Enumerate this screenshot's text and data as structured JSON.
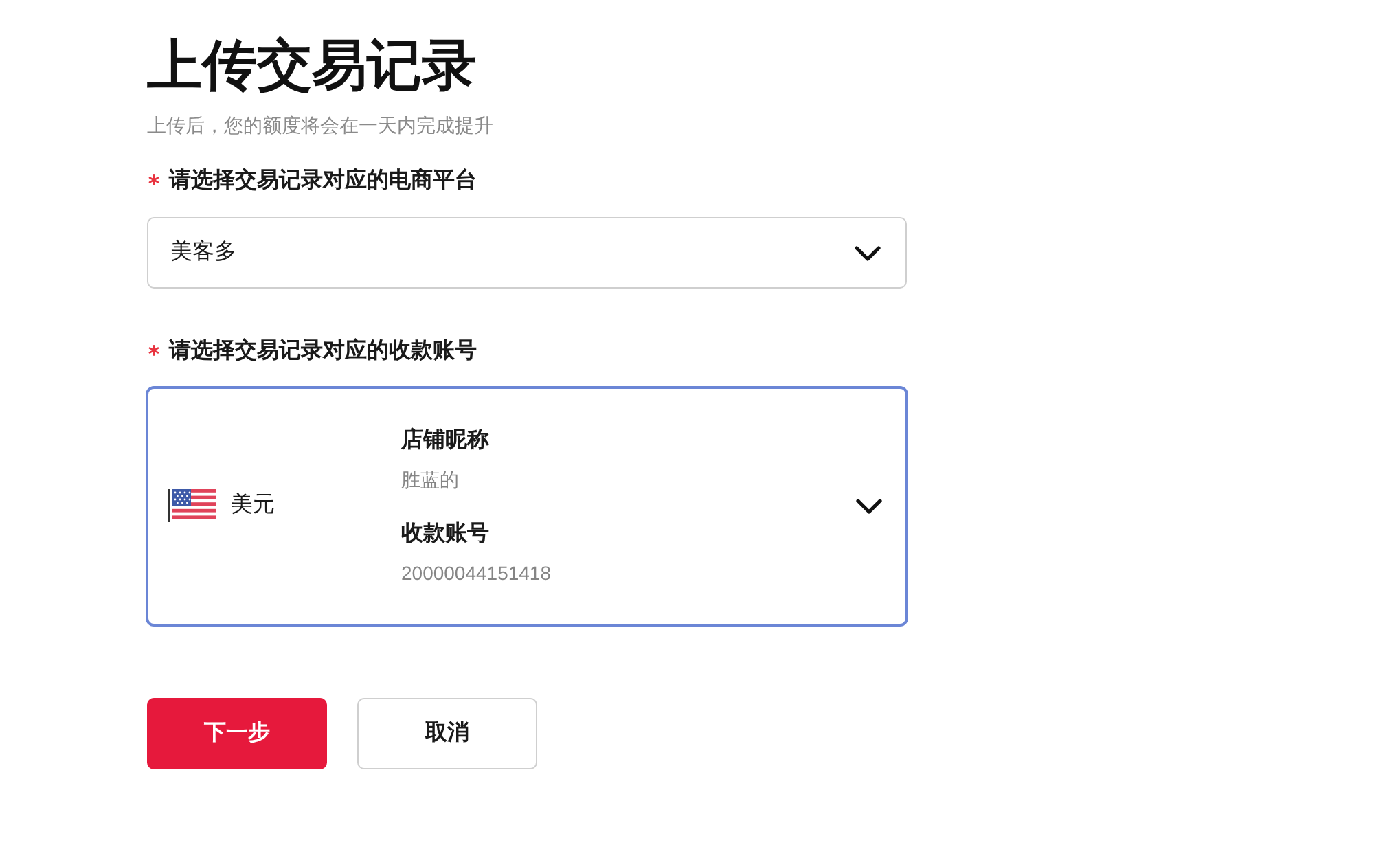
{
  "title": "上传交易记录",
  "subtitle": "上传后，您的额度将会在一天内完成提升",
  "fields": [
    {
      "kind": "select",
      "label": "请选择交易记录对应的电商平台",
      "required": true,
      "focused": false,
      "value": "美客多"
    },
    {
      "kind": "account",
      "label": "请选择交易记录对应的收款账号",
      "required": true,
      "focused": true,
      "currency": "美元",
      "shop_name_label": "店铺昵称",
      "shop_name": "胜蓝的",
      "account_label": "收款账号",
      "account_number": "20000044151418"
    }
  ],
  "buttons": [
    {
      "label": "下一步",
      "kind": "primary"
    },
    {
      "label": "取消",
      "kind": "secondary"
    }
  ]
}
